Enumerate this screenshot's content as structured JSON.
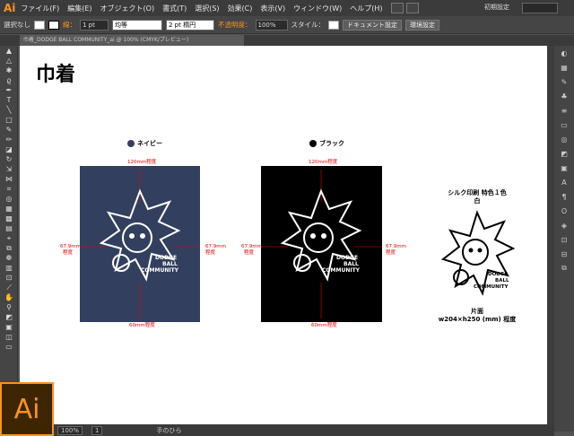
{
  "app": {
    "logo": "Ai",
    "workspace": "初期設定"
  },
  "menu": [
    "ファイル(F)",
    "編集(E)",
    "オブジェクト(O)",
    "書式(T)",
    "選択(S)",
    "効果(C)",
    "表示(V)",
    "ウィンドウ(W)",
    "ヘルプ(H)"
  ],
  "control": {
    "selection": "選択なし",
    "stroke_label": "線：",
    "stroke_value": "1 pt",
    "stroke_style": "均等",
    "brush": "2 pt 楕円",
    "opacity_label": "不透明度：",
    "opacity_value": "100%",
    "style_label": "スタイル：",
    "doc_setup": "ドキュメント設定",
    "env_setup": "環境設定"
  },
  "tab": {
    "title": "巾着_DODGE BALL COMMUNITY_ai @ 100% (CMYK/プレビュー)"
  },
  "canvas": {
    "title": "巾着",
    "bags": [
      {
        "color_name": "ネイビー",
        "color": "#333f5e",
        "dot": "#333f5e",
        "top": "120mm程度",
        "bottom": "60mm程度",
        "left": "67.9mm",
        "left2": "程度",
        "right": "67.9mm",
        "right2": "程度"
      },
      {
        "color_name": "ブラック",
        "color": "#000000",
        "dot": "#000000",
        "top": "120mm程度",
        "bottom": "60mm程度",
        "left": "67.9mm",
        "left2": "程度",
        "right": "67.9mm",
        "right2": "程度"
      }
    ],
    "logo_text": [
      "DODGE",
      "BALL",
      "COMMUNITY"
    ],
    "print_note": {
      "line1": "シルク印刷 特色１色",
      "line2": "白",
      "line3": "片面",
      "line4": "w204×h250 (mm) 程度"
    }
  },
  "status": {
    "zoom": "100%",
    "page": "1",
    "tool": "手のひら"
  },
  "icons": [
    "selection-icon",
    "direct-selection-icon",
    "magic-wand-icon",
    "lasso-icon",
    "pen-icon",
    "type-icon",
    "line-icon",
    "rectangle-icon",
    "paintbrush-icon",
    "pencil-icon",
    "eraser-icon",
    "rotate-icon",
    "scale-icon",
    "width-icon",
    "free-transform-icon",
    "shape-builder-icon",
    "perspective-icon",
    "mesh-icon",
    "gradient-icon",
    "eyedropper-icon",
    "blend-icon",
    "symbol-sprayer-icon",
    "graph-icon",
    "artboard-icon",
    "slice-icon",
    "hand-icon",
    "zoom-icon"
  ]
}
